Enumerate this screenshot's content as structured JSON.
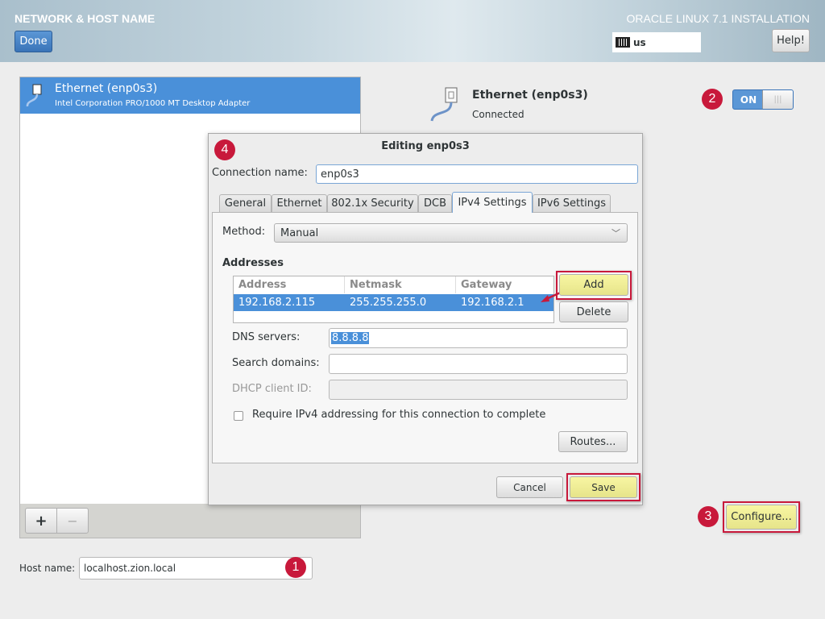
{
  "header": {
    "title": "NETWORK & HOST NAME",
    "done_label": "Done",
    "product": "ORACLE LINUX 7.1 INSTALLATION",
    "keyboard_layout": "us",
    "help_label": "Help!"
  },
  "device_list": {
    "items": [
      {
        "name": "Ethernet (enp0s3)",
        "description": "Intel Corporation PRO/1000 MT Desktop Adapter"
      }
    ],
    "add_label": "+",
    "remove_label": "−"
  },
  "device_detail": {
    "name": "Ethernet (enp0s3)",
    "status": "Connected",
    "toggle_label": "ON",
    "toggle_on": true,
    "configure_label": "Configure..."
  },
  "dialog": {
    "title": "Editing enp0s3",
    "connection_name_label": "Connection name:",
    "connection_name": "enp0s3",
    "tabs": [
      {
        "label": "General"
      },
      {
        "label": "Ethernet"
      },
      {
        "label": "802.1x Security"
      },
      {
        "label": "DCB"
      },
      {
        "label": "IPv4 Settings",
        "active": true
      },
      {
        "label": "IPv6 Settings"
      }
    ],
    "method_label": "Method:",
    "method": "Manual",
    "addresses_label": "Addresses",
    "columns": [
      "Address",
      "Netmask",
      "Gateway"
    ],
    "rows": [
      [
        "192.168.2.115",
        "255.255.255.0",
        "192.168.2.1"
      ]
    ],
    "add_label": "Add",
    "delete_label": "Delete",
    "dns_label": "DNS servers:",
    "dns": "8.8.8.8",
    "search_label": "Search domains:",
    "search": "",
    "dhcp_label": "DHCP client ID:",
    "dhcp": "",
    "require_label": "Require IPv4 addressing for this connection to complete",
    "require_checked": false,
    "routes_label": "Routes...",
    "cancel_label": "Cancel",
    "save_label": "Save"
  },
  "host": {
    "label": "Host name:",
    "value": "localhost.zion.local"
  },
  "annotations": [
    "1",
    "2",
    "3",
    "4"
  ],
  "colors": {
    "accent": "#4a90d9",
    "annotation": "#c8193b",
    "highlight": "#f0ee95"
  }
}
